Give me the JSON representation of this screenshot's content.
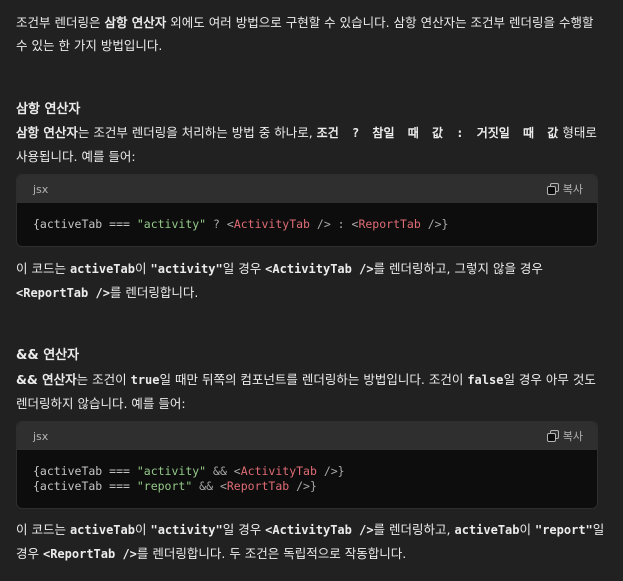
{
  "para1": {
    "a": "조건부 렌더링은 ",
    "b": "삼항 연산자",
    "c": " 외에도 여러 방법으로 구현할 수 있습니다. 삼항 연산자는 조건부 렌더링을 수행할 수 있는 한 가지 방법입니다."
  },
  "heading1": "삼항 연산자",
  "para2": {
    "a": "삼항 연산자",
    "b": "는 조건부 렌더링을 처리하는 방법 중 하나로, ",
    "c": "조건 ? 참일 때 값 : 거짓일 때 값",
    "d": " 형태로 사용됩니다. 예를 들어:"
  },
  "code1": {
    "lang": "jsx",
    "copy_label": "복사",
    "line1": {
      "t1": "{activeTab === ",
      "t2": "\"activity\"",
      "t3": " ? <",
      "t4": "ActivityTab",
      "t5": " /> : <",
      "t6": "ReportTab",
      "t7": " />}"
    }
  },
  "para3": {
    "a": "이 코드는 ",
    "b": "activeTab",
    "c": "이 ",
    "d": "\"activity\"",
    "e": "일 경우 ",
    "f": "<ActivityTab />",
    "g": "를 렌더링하고, 그렇지 않을 경우 ",
    "h": "<ReportTab />",
    "i": "를 렌더링합니다."
  },
  "heading2": "&& 연산자",
  "para4": {
    "a": "&& 연산자",
    "b": "는 조건이 ",
    "c": "true",
    "d": "일 때만 뒤쪽의 컴포넌트를 렌더링하는 방법입니다. 조건이 ",
    "e": "false",
    "f": "일 경우 아무 것도 렌더링하지 않습니다. 예를 들어:"
  },
  "code2": {
    "lang": "jsx",
    "copy_label": "복사",
    "line1": {
      "t1": "{activeTab === ",
      "t2": "\"activity\"",
      "t3": " && <",
      "t4": "ActivityTab",
      "t5": " />}"
    },
    "line2": {
      "t1": "{activeTab === ",
      "t2": "\"report\"",
      "t3": " && <",
      "t4": "ReportTab",
      "t5": " />}"
    }
  },
  "para5": {
    "a": "이 코드는 ",
    "b": "activeTab",
    "c": "이 ",
    "d": "\"activity\"",
    "e": "일 경우 ",
    "f": "<ActivityTab />",
    "g": "를 렌더링하고, ",
    "h": "activeTab",
    "i": "이 ",
    "j": "\"report\"",
    "k": "일 경우 ",
    "l": "<ReportTab />",
    "m": "를 렌더링합니다. 두 조건은 독립적으로 작동합니다."
  },
  "colors": {
    "background": "#212121",
    "text": "#ececec",
    "code_bg": "#0d0d0d",
    "code_header_bg": "#2f2f2f",
    "string": "#94c98a",
    "tag": "#e06c75"
  },
  "icons": {
    "copy": "copy-icon"
  }
}
